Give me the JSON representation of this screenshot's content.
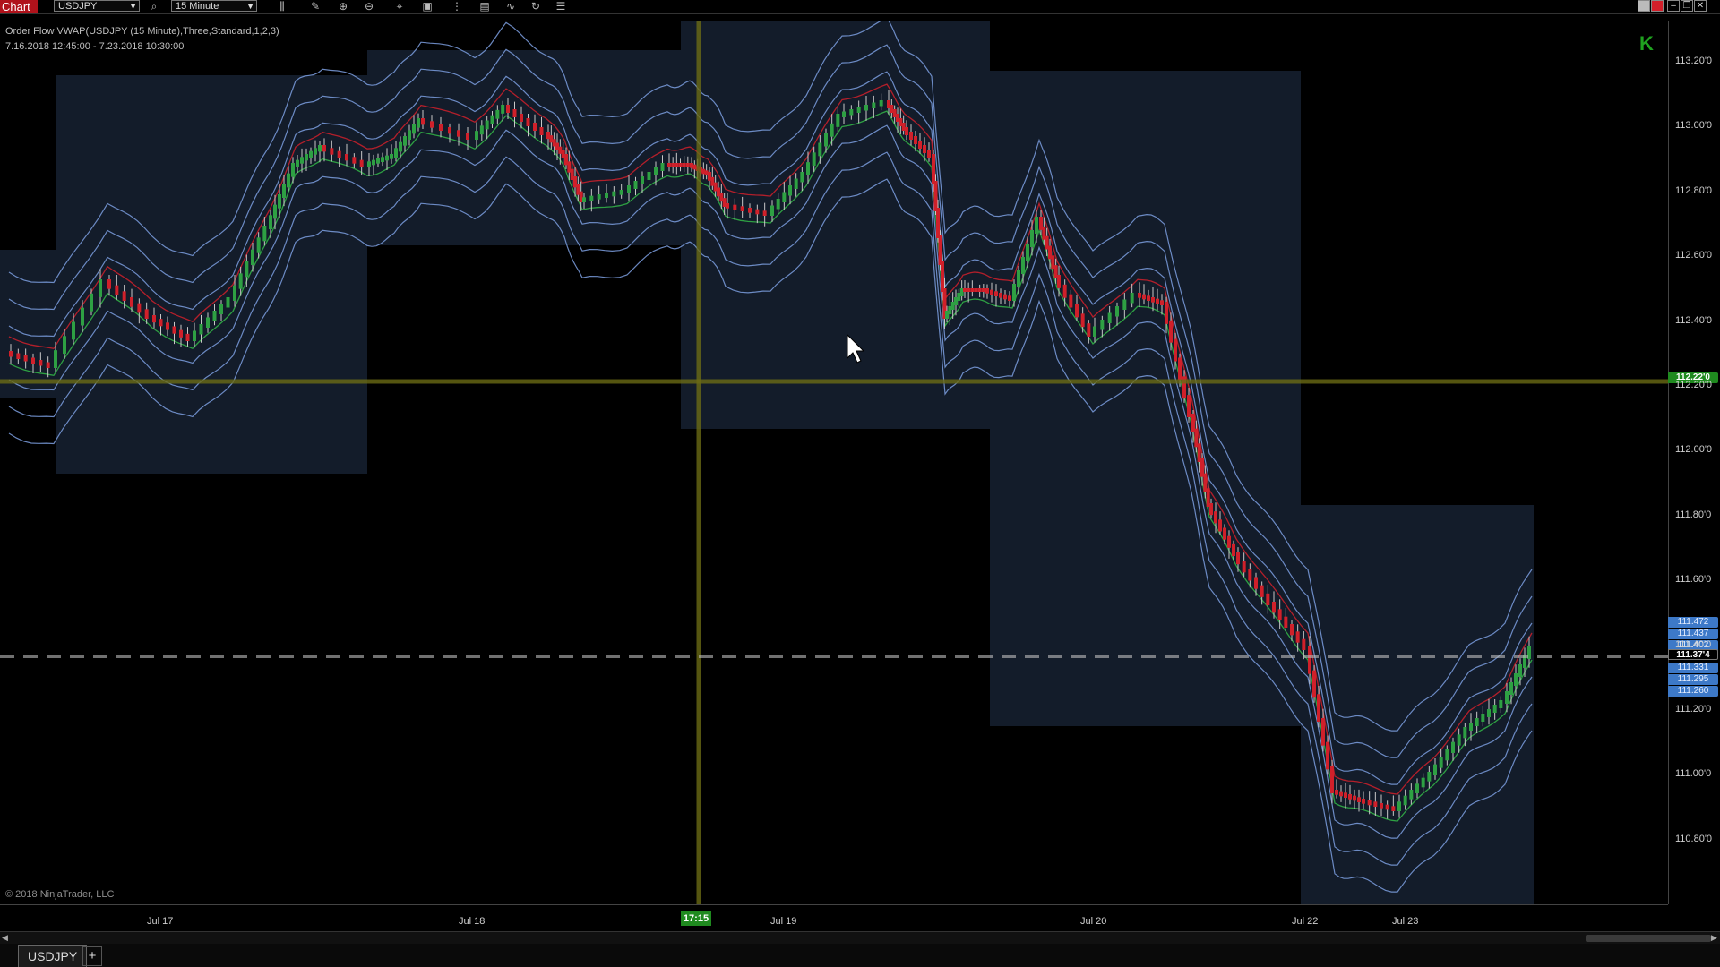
{
  "toolbar": {
    "title": "Chart",
    "instrument": "USDJPY",
    "interval": "15 Minute"
  },
  "chart": {
    "indicator_label": "Order Flow VWAP(USDJPY (15 Minute),Three,Standard,1,2,3)",
    "date_range": "7.16.2018 12:45:00 - 7.23.2018 10:30:00",
    "copyright": "© 2018 NinjaTrader, LLC",
    "crosshair_price": "112.22'0",
    "crosshair_time": "17:15",
    "last_price": "111.37'4"
  },
  "y_axis_labels": [
    "113.20'0",
    "113.00'0",
    "112.80'0",
    "112.60'0",
    "112.40'0",
    "112.20'0",
    "112.00'0",
    "111.80'0",
    "111.60'0",
    "111.40'0",
    "111.20'0",
    "111.00'0",
    "110.80'0"
  ],
  "x_axis_labels": [
    "Jul 17",
    "Jul 18",
    "Jul 19",
    "Jul 20",
    "Jul 22",
    "Jul 23"
  ],
  "price_tags": [
    "111.472",
    "111.437",
    "111.402",
    "111.331",
    "111.295",
    "111.260"
  ],
  "tabs": {
    "active": "USDJPY",
    "add_label": "+"
  },
  "colors": {
    "vwap": "#2ea043",
    "prior_vwap": "#d0202a",
    "band": "#7d9fe0",
    "band_fill": "#1a2538",
    "crosshair": "#6b6b15",
    "up_candle": "#2ea043",
    "down_candle": "#d0202a",
    "wick": "#c8c8c8"
  }
}
